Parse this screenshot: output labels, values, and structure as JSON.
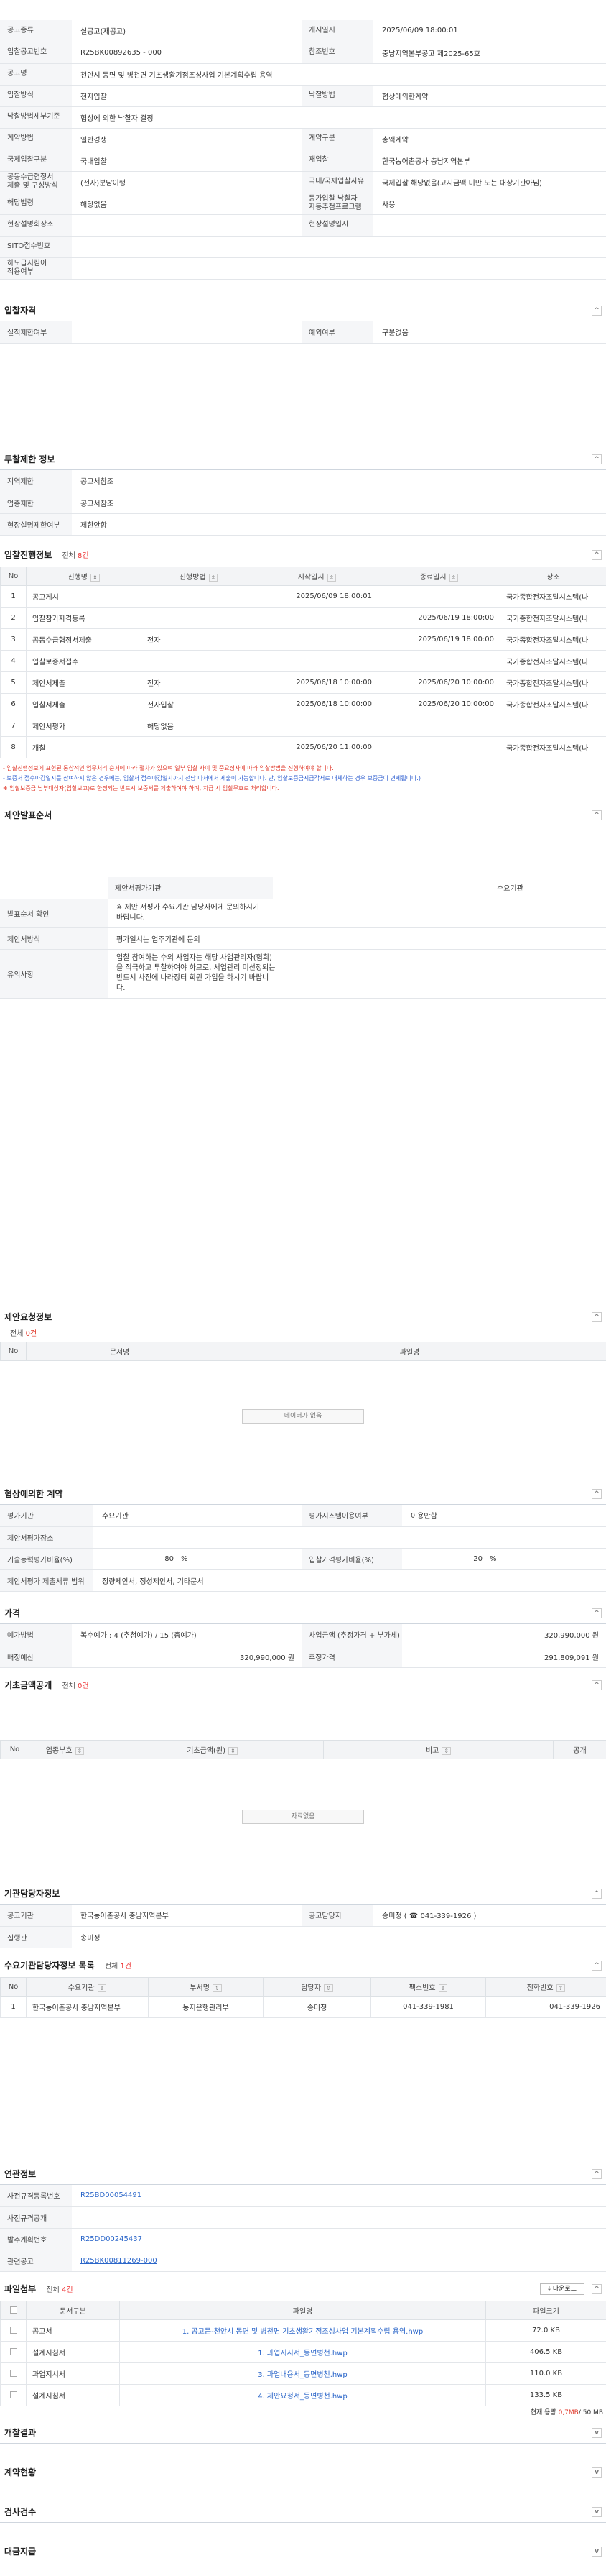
{
  "basic": {
    "rows": [
      {
        "k1": "공고종류",
        "v1": "실공고(재공고)",
        "k2": "게시일시",
        "v2": "2025/06/09 18:00:01"
      },
      {
        "k1": "입찰공고번호",
        "v1": "R25BK00892635 - 000",
        "k2": "참조번호",
        "v2": "충남지역본부공고 제2025-65호"
      },
      {
        "k1": "공고명",
        "v1": "천안시 동면 및 병천면 기초생활기점조성사업 기본계획수립 용역",
        "k2": "",
        "v2": ""
      },
      {
        "k1": "입찰방식",
        "v1": "전자입찰",
        "k2": "낙찰방법",
        "v2": "협상에의한계약"
      },
      {
        "k1": "낙찰방법세부기준",
        "v1": "협상에 의한 낙찰자 결정",
        "k2": "",
        "v2": ""
      },
      {
        "k1": "계약방법",
        "v1": "일반경쟁",
        "k2": "계약구분",
        "v2": "총액계약"
      },
      {
        "k1": "국제입찰구분",
        "v1": "국내입찰",
        "k2": "재입찰",
        "v2": "한국농어촌공사 충남지역본부"
      },
      {
        "k1": "공동수급협정서\n제출 및 구성방식",
        "v1": "(전자)분담이행",
        "k2": "국내/국제입찰사유",
        "v2": "국제입찰 해당없음(고시금액 미만 또는 대상기관아님)"
      },
      {
        "k1": "해당법령",
        "v1": "해당없음",
        "k2": "동가입찰 낙찰자\n자동추첨프로그램",
        "v2": "사용"
      },
      {
        "k1": "현장설명회장소",
        "v1": "",
        "k2": "현장설명일시",
        "v2": ""
      },
      {
        "k1": "SITO접수번호",
        "v1": "",
        "k2": "",
        "v2": ""
      },
      {
        "k1": "하도급지킴이\n적용여부",
        "v1": "",
        "k2": "",
        "v2": ""
      }
    ]
  },
  "bid_qual": {
    "title": "입찰자격",
    "k1": "실적제한여부",
    "v1": "",
    "k2": "예외여부",
    "v2": "구분없음"
  },
  "region": {
    "title": "투찰제한 정보",
    "rows": [
      {
        "k": "지역제한",
        "v": "공고서참조"
      },
      {
        "k": "업종제한",
        "v": "공고서참조"
      },
      {
        "k": "현장설명제한여부",
        "v": "제한안함"
      }
    ]
  },
  "progress": {
    "title": "입찰진행정보",
    "count_label": "전체",
    "count": "8건",
    "headers": [
      "No",
      "진행명",
      "진행방법",
      "시작일시",
      "종료일시",
      "장소"
    ],
    "rows": [
      {
        "no": "1",
        "name": "공고게시",
        "method": "",
        "start": "2025/06/09 18:00:01",
        "end": "",
        "place": "국가종합전자조달시스템(나"
      },
      {
        "no": "2",
        "name": "입찰참가자격등록",
        "method": "",
        "start": "",
        "end": "2025/06/19 18:00:00",
        "place": "국가종합전자조달시스템(나"
      },
      {
        "no": "3",
        "name": "공동수급협정서제출",
        "method": "전자",
        "start": "",
        "end": "2025/06/19 18:00:00",
        "place": "국가종합전자조달시스템(나"
      },
      {
        "no": "4",
        "name": "입찰보증서접수",
        "method": "",
        "start": "",
        "end": "",
        "place": "국가종합전자조달시스템(나"
      },
      {
        "no": "5",
        "name": "제안서제출",
        "method": "전자",
        "start": "2025/06/18 10:00:00",
        "end": "2025/06/20 10:00:00",
        "place": "국가종합전자조달시스템(나"
      },
      {
        "no": "6",
        "name": "입찰서제출",
        "method": "전자입찰",
        "start": "2025/06/18 10:00:00",
        "end": "2025/06/20 10:00:00",
        "place": "국가종합전자조달시스템(나"
      },
      {
        "no": "7",
        "name": "제안서평가",
        "method": "해당없음",
        "start": "",
        "end": "",
        "place": ""
      },
      {
        "no": "8",
        "name": "개찰",
        "method": "",
        "start": "2025/06/20 11:00:00",
        "end": "",
        "place": "국가종합전자조달시스템(나"
      }
    ],
    "notes": [
      "- 입찰진행정보에 표현된 통상적인 업무처리 순서에 따라 절차가 있으며 일부 입찰 사이 및 중요정사에 따라 입찰방법을 진행하여야 합니다.",
      "- 보증서 접수마감일시를 참여하지 않은 경우에는, 입찰서 접수마감일시까지 전담 나서에서 제출이 가능합니다. 단, 입찰보증금지급각서로 대체하는 경우 보증금이 면제됩니다.)",
      "※ 입찰보증금 납부대상자(입찰보고)로 한정되는 반드시 보증서를 제출하여야 하며, 지급 시 입찰무효로 처리합니다."
    ]
  },
  "proposal": {
    "title": "제안발표순서",
    "eval_label": "제안서평가기관",
    "eval_value": "",
    "eval_k2": "수요기관",
    "order_k": "발표순서 확인",
    "order_v": "※ 제안 서평가 수요기관 담당자에게 문의하시기 바랍니다.",
    "method_k": "제안서방식",
    "method_v": "평가일시는 업주기관에 문의",
    "note_k": "유의사항",
    "note_v": "입찰 참여하는 수의 사업자는 해당 사업관리자(협회)을 적극하고 투찰하여야 하므로, 서업관리 미선정되는 반드시 사전에 나라장터 회원 가입을 하시기 바랍니다."
  },
  "request": {
    "title": "제안요청정보",
    "count_label": "전체",
    "count": "0건",
    "headers": [
      "No",
      "문서명",
      "파일명"
    ],
    "nodata": "데이터가 없음"
  },
  "negotiation": {
    "title": "협상에의한 계약",
    "rows": [
      {
        "k1": "평가기관",
        "v1": "수요기관",
        "k2": "평가시스템이용여부",
        "v2": "이용안함"
      },
      {
        "k1": "제안서평가장소",
        "v1": "",
        "k2": "",
        "v2": ""
      },
      {
        "k1": "기술능력평가비율(%)",
        "v1": "80",
        "u1": "%",
        "k2": "입찰가격평가비율(%)",
        "v2": "20",
        "u2": "%"
      },
      {
        "k1": "제안서평가 제출서류 범위",
        "v1": "정량제안서, 정성제안서, 기타문서",
        "k2": "",
        "v2": ""
      }
    ]
  },
  "price": {
    "title": "가격",
    "k1": "예가방법",
    "v1": "복수예가 : 4 (추첨예가) / 15 (총예가)",
    "k2": "사업금액 (추정가격 + 부가세)",
    "v2": "320,990,000 원",
    "k3": "배정예산",
    "v3": "320,990,000 원",
    "k4": "추정가격",
    "v4": "291,809,091 원"
  },
  "basis": {
    "title": "기초금액공개",
    "count_label": "전체",
    "count": "0건",
    "headers": [
      "No",
      "업종부호",
      "기초금액(원)",
      "비고",
      "공개"
    ],
    "nodata": "자료없음"
  },
  "contract": {
    "title": "기관담당자정보",
    "k1": "공고기관",
    "v1": "한국농어촌공사 충남지역본부",
    "k2": "공고담당자",
    "v2": "송미정 ( ☎ 041-339-1926 )",
    "k3": "집행관",
    "v3": "송미정"
  },
  "demand": {
    "title": "수요기관담당자정보 목록",
    "count_label": "전체",
    "count": "1건",
    "headers": [
      "No",
      "수요기관",
      "부서명",
      "담당자",
      "팩스번호",
      "전화번호"
    ],
    "rows": [
      {
        "no": "1",
        "org": "한국농어촌공사 충남지역본부",
        "dept": "농지은행관리부",
        "person": "송미정",
        "fax": "041-339-1981",
        "tel": "041-339-1926"
      }
    ]
  },
  "link": {
    "title": "연관정보",
    "rows": [
      {
        "k": "사전규격등록번호",
        "v": "R25BD00054491"
      },
      {
        "k": "사전규격공개",
        "v": ""
      },
      {
        "k": "발주계획번호",
        "v": "R25DD00245437"
      },
      {
        "k": "관련공고",
        "v": "R25BK00811269-000"
      }
    ]
  },
  "files": {
    "title": "파일첨부",
    "count_label": "전체",
    "count": "4건",
    "download_label": "다운로드",
    "headers": [
      "문서구분",
      "파일명",
      "파일크기"
    ],
    "rows": [
      {
        "type": "공고서",
        "name": "1. 공고문-천안시 동면 및 병천면 기초생활기점조성사업 기본계획수립 용역.hwp",
        "size": "72.0 KB"
      },
      {
        "type": "설계지침서",
        "name": "1. 과업지시서_동면병천.hwp",
        "size": "406.5 KB"
      },
      {
        "type": "과업지시서",
        "name": "3. 과업내용서_동면병천.hwp",
        "size": "110.0 KB"
      },
      {
        "type": "설계지침서",
        "name": "4. 제안요청서_동면병천.hwp",
        "size": "133.5 KB"
      }
    ],
    "total_label": "현재 용량",
    "total_used": "0,7MB",
    "total_max": "/ 50 MB"
  },
  "tail": {
    "t1": "개찰결과",
    "t2": "계약현황",
    "t3": "검사검수",
    "t4": "대금지급"
  }
}
